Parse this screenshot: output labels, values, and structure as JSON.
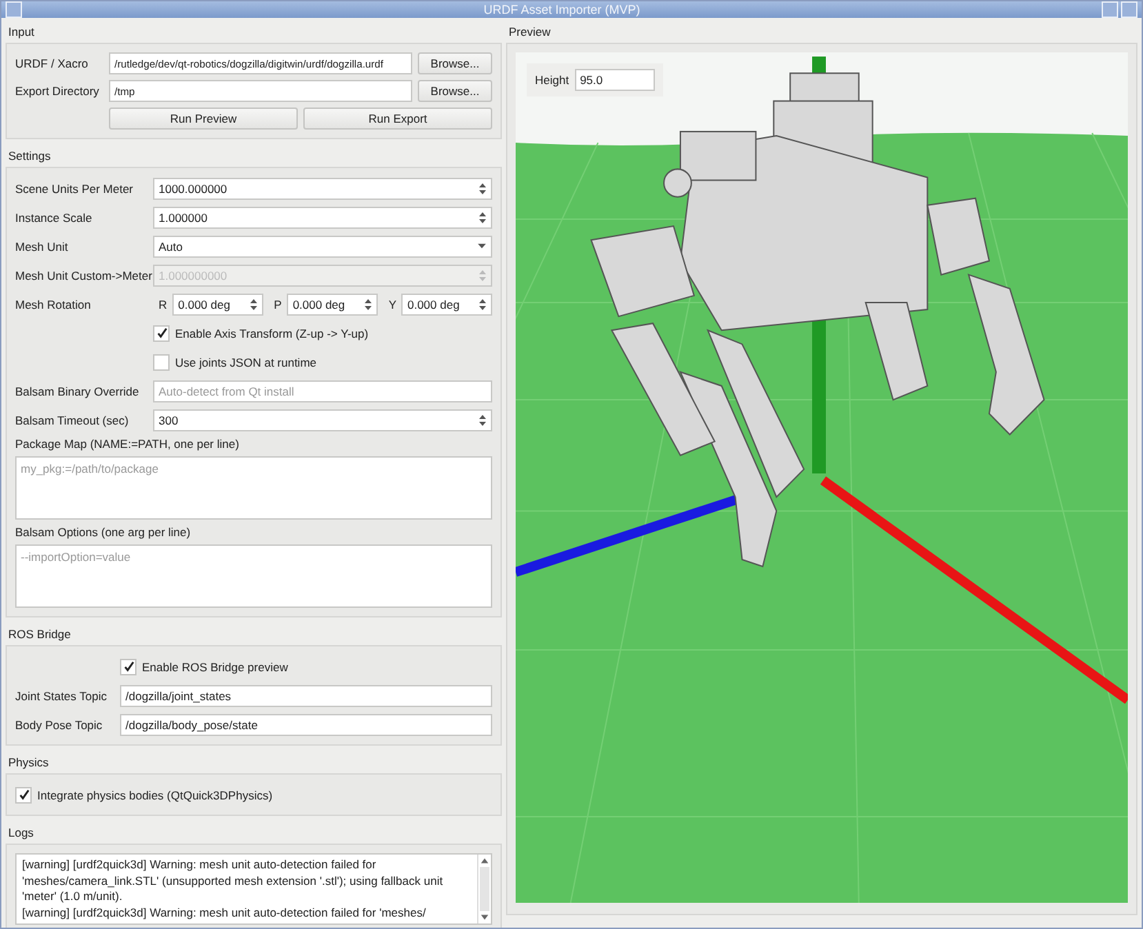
{
  "window": {
    "title": "URDF Asset Importer (MVP)"
  },
  "input": {
    "title": "Input",
    "fields": [
      {
        "label": "URDF / Xacro",
        "value": "/rutledge/dev/qt-robotics/dogzilla/digitwin/urdf/dogzilla.urdf",
        "button": "Browse..."
      },
      {
        "label": "Export Directory",
        "value": "/tmp",
        "button": "Browse..."
      }
    ],
    "buttons": [
      "Run Preview",
      "Run Export"
    ]
  },
  "settings": {
    "title": "Settings",
    "rows": [
      {
        "kind": "spin",
        "label": "Scene Units Per Meter",
        "value": "1000.000000",
        "disabled": false
      },
      {
        "kind": "spin",
        "label": "Instance Scale",
        "value": "1.000000",
        "disabled": false
      },
      {
        "kind": "combo",
        "label": "Mesh Unit",
        "value": "Auto"
      },
      {
        "kind": "spin",
        "label": "Mesh Unit Custom->Meter",
        "value": "1.000000000",
        "disabled": true
      },
      {
        "kind": "rotation",
        "label": "Mesh Rotation",
        "parts": [
          {
            "axis": "R",
            "value": "0.000 deg"
          },
          {
            "axis": "P",
            "value": "0.000 deg"
          },
          {
            "axis": "Y",
            "value": "0.000 deg"
          }
        ]
      },
      {
        "kind": "check",
        "label": "Enable Axis Transform (Z-up -> Y-up)",
        "checked": true
      },
      {
        "kind": "check",
        "label": "Use joints JSON at runtime",
        "checked": false
      },
      {
        "kind": "text",
        "label": "Balsam Binary Override",
        "placeholder": "Auto-detect from Qt install"
      },
      {
        "kind": "spin",
        "label": "Balsam Timeout (sec)",
        "value": "300",
        "disabled": false
      },
      {
        "kind": "area",
        "label": "Package Map (NAME:=PATH, one per line)",
        "placeholder": "my_pkg:=/path/to/package"
      },
      {
        "kind": "area",
        "label": "Balsam Options (one arg per line)",
        "placeholder": "--importOption=value"
      }
    ]
  },
  "ros_bridge": {
    "title": "ROS Bridge",
    "rows": [
      {
        "kind": "check",
        "label": "Enable ROS Bridge preview",
        "checked": true
      },
      {
        "kind": "text",
        "label": "Joint States Topic",
        "value": "/dogzilla/joint_states"
      },
      {
        "kind": "text",
        "label": "Body Pose Topic",
        "value": "/dogzilla/body_pose/state"
      }
    ]
  },
  "physics": {
    "title": "Physics",
    "rows": [
      {
        "kind": "check",
        "label": "Integrate physics bodies (QtQuick3DPhysics)",
        "checked": true
      }
    ]
  },
  "logs": {
    "title": "Logs",
    "entries": [
      "[warning] [urdf2quick3d] Warning: mesh unit auto-detection failed for 'meshes/camera_link.STL' (unsupported mesh extension '.stl'); using fallback unit 'meter' (1.0 m/unit).",
      "[warning] [urdf2quick3d] Warning: mesh unit auto-detection failed for 'meshes/"
    ]
  },
  "preview": {
    "title": "Preview",
    "height_label": "Height",
    "height_value": "95.0"
  }
}
